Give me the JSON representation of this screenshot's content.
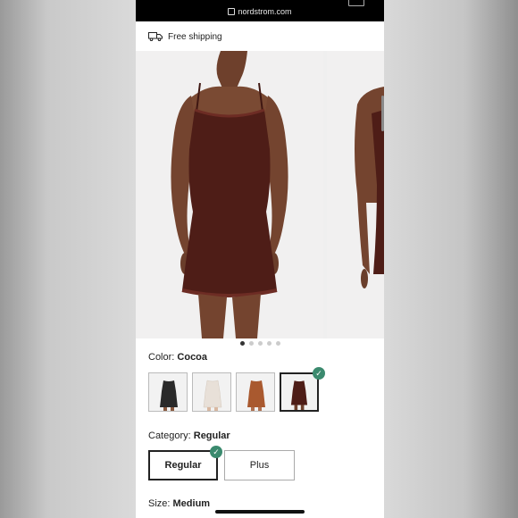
{
  "browser": {
    "url": "nordstrom.com"
  },
  "shipping": {
    "text": "Free shipping"
  },
  "gallery": {
    "dot_count": 5,
    "active_index": 0
  },
  "color": {
    "label": "Color: ",
    "value": "Cocoa",
    "swatches": [
      {
        "name": "Black",
        "color": "#2a2a2a"
      },
      {
        "name": "Ivory",
        "color": "#e8e0d8"
      },
      {
        "name": "Bronze",
        "color": "#a9592f"
      },
      {
        "name": "Cocoa",
        "color": "#4e1d17",
        "selected": true
      }
    ]
  },
  "category": {
    "label": "Category: ",
    "value": "Regular",
    "options": [
      {
        "label": "Regular",
        "selected": true
      },
      {
        "label": "Plus",
        "selected": false
      }
    ]
  },
  "size": {
    "label": "Size: ",
    "value": "Medium"
  },
  "colors": {
    "dress": "#4e1d17",
    "skin": "#7a4a33",
    "check_green": "#3b8a6e"
  }
}
